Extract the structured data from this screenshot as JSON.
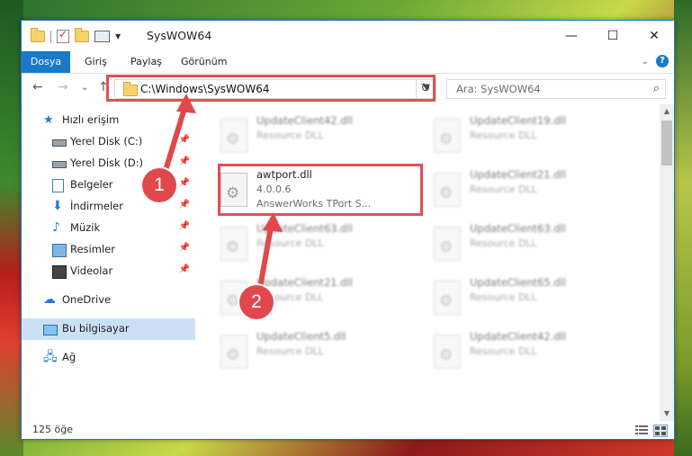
{
  "window": {
    "title": "SysWOW64"
  },
  "titlebar_buttons": {
    "minimize": "—",
    "maximize": "☐",
    "close": "✕"
  },
  "ribbon": {
    "tabs": [
      "Dosya",
      "Giriş",
      "Paylaş",
      "Görünüm"
    ],
    "active_tab": "Dosya",
    "collapse": "⌄",
    "help": "?"
  },
  "navigation": {
    "back": "←",
    "forward": "→",
    "recent": "⌄",
    "up": "↑",
    "path": "C:\\Windows\\SysWOW64",
    "refresh": "↻",
    "search_placeholder": "Ara: SysWOW64",
    "search_icon": "⌕"
  },
  "sidebar": {
    "items": [
      {
        "label": "Hızlı erişim",
        "icon": "star-icon"
      },
      {
        "label": "Yerel Disk (C:)",
        "icon": "disk-icon",
        "pinned": true
      },
      {
        "label": "Yerel Disk (D:)",
        "icon": "disk-icon",
        "pinned": true
      },
      {
        "label": "Belgeler",
        "icon": "document-icon",
        "pinned": true
      },
      {
        "label": "İndirmeler",
        "icon": "download-icon",
        "pinned": true
      },
      {
        "label": "Müzik",
        "icon": "music-icon",
        "pinned": true
      },
      {
        "label": "Resimler",
        "icon": "picture-icon",
        "pinned": true
      },
      {
        "label": "Videolar",
        "icon": "video-icon",
        "pinned": true
      },
      {
        "label": "OneDrive",
        "icon": "cloud-icon"
      },
      {
        "label": "Bu bilgisayar",
        "icon": "computer-icon",
        "selected": true
      },
      {
        "label": "Ağ",
        "icon": "network-icon"
      }
    ]
  },
  "files": {
    "left": [
      {
        "name": "UpdateClient42.dll",
        "sub1": "Resource DLL",
        "sub2": ""
      },
      {
        "name": "awtport.dll",
        "sub1": "4.0.0.6",
        "sub2": "AnswerWorks TPort S..."
      },
      {
        "name": "UpdateClient63.dll",
        "sub1": "Resource DLL",
        "sub2": ""
      },
      {
        "name": "UpdateClient21.dll",
        "sub1": "Resource DLL",
        "sub2": ""
      },
      {
        "name": "UpdateClient5.dll",
        "sub1": "Resource DLL",
        "sub2": ""
      }
    ],
    "right": [
      {
        "name": "UpdateClient19.dll",
        "sub1": "Resource DLL",
        "sub2": ""
      },
      {
        "name": "UpdateClient21.dll",
        "sub1": "Resource DLL",
        "sub2": ""
      },
      {
        "name": "UpdateClient63.dll",
        "sub1": "Resource DLL",
        "sub2": ""
      },
      {
        "name": "UpdateClient65.dll",
        "sub1": "Resource DLL",
        "sub2": ""
      },
      {
        "name": "UpdateClient42.dll",
        "sub1": "Resource DLL",
        "sub2": ""
      }
    ]
  },
  "status": {
    "count": "125 öğe"
  },
  "annotations": {
    "step1": "1",
    "step2": "2",
    "color": "#e0484d"
  },
  "scroll": {
    "up": "▲",
    "down": "▼"
  }
}
